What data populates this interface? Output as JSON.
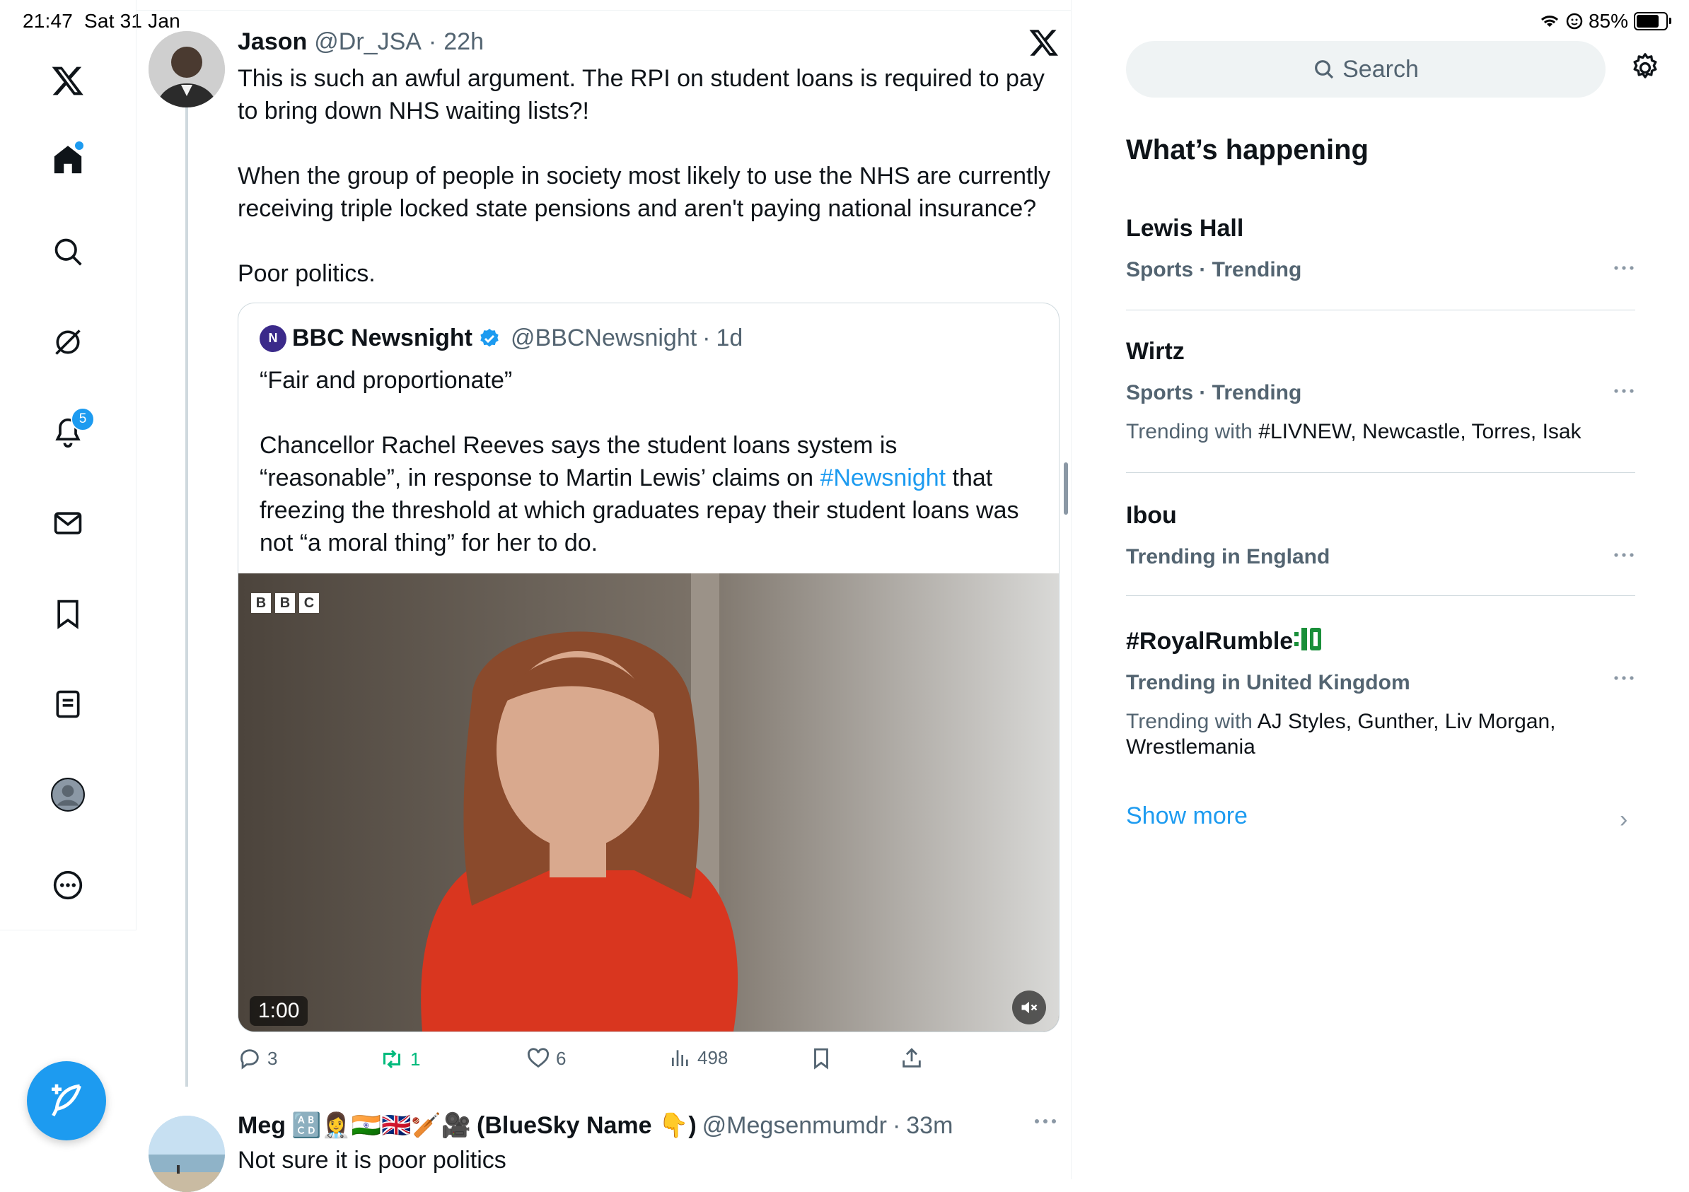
{
  "status_bar": {
    "time": "21:47",
    "date": "Sat 31 Jan",
    "battery": "85%",
    "battery_level": 0.85
  },
  "nav": {
    "notifications_badge": "5",
    "icons": [
      "x-logo-icon",
      "home-icon",
      "search-icon",
      "grok-icon",
      "bell-icon",
      "mail-icon",
      "bookmark-icon",
      "lists-icon",
      "profile-icon",
      "more-icon"
    ]
  },
  "tweet": {
    "author_name": "Jason",
    "author_handle": "@Dr_JSA",
    "time": "22h",
    "paragraphs": [
      "This is such an awful argument. The RPI on student loans is required to pay to bring down NHS waiting lists?!",
      "When the group of people in society most likely to use the NHS are currently receiving triple locked state pensions and aren't paying national insurance?",
      "Poor politics."
    ],
    "quote": {
      "author_name": "BBC Newsnight",
      "author_handle": "@BBCNewsnight",
      "time": "1d",
      "line1": "“Fair and proportionate”",
      "para2_before": "Chancellor Rachel Reeves says the student loans system is “reasonable”, in response to Martin Lewis’ claims on ",
      "hashtag": "#Newsnight",
      "para2_after": " that freezing the threshold at which graduates repay their student loans was not “a moral thing” for her to do.",
      "video_logo": [
        "B",
        "B",
        "C"
      ],
      "video_duration": "1:00"
    },
    "actions": {
      "replies": "3",
      "reposts": "1",
      "likes": "6",
      "views": "498"
    }
  },
  "reply": {
    "author_name": "Meg",
    "author_emojis": "🔠👩‍⚕️🇮🇳🇬🇧🏏🎥",
    "author_suffix": "(BlueSky Name 👇)",
    "author_handle": "@Megsenmumdr",
    "time": "33m",
    "text": "Not sure it is poor politics"
  },
  "search": {
    "placeholder": "Search"
  },
  "whats_happening": {
    "title": "What’s happening",
    "trends": [
      {
        "name": "Lewis Hall",
        "meta": "Sports · Trending",
        "with_label": "",
        "with": ""
      },
      {
        "name": "Wirtz",
        "meta": "Sports · Trending",
        "with_label": "Trending with ",
        "with": "#LIVNEW, Newcastle, Torres, Isak"
      },
      {
        "name": "Ibou",
        "meta": "Trending in England",
        "with_label": "",
        "with": ""
      },
      {
        "name": "#RoyalRumble",
        "meta": "Trending in United Kingdom",
        "with_label": "Trending with ",
        "with": "AJ Styles, Gunther, Liv Morgan, Wrestlemania"
      }
    ],
    "show_more": "Show more"
  },
  "colors": {
    "accent": "#1d9bf0",
    "repost_green": "#00ba7c",
    "muted": "#536471"
  }
}
